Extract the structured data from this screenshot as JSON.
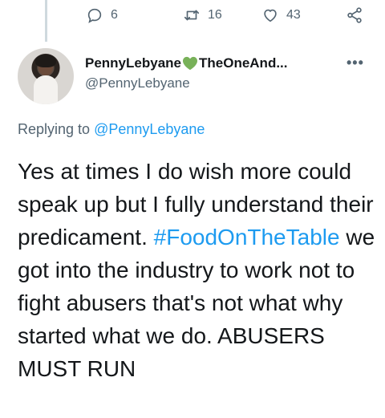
{
  "actions": {
    "reply_icon": "reply-icon",
    "reply_count": "6",
    "retweet_icon": "retweet-icon",
    "retweet_count": "16",
    "like_icon": "heart-icon",
    "like_count": "43",
    "share_icon": "share-icon"
  },
  "tweet": {
    "display_name_part1": "PennyLebyane",
    "display_name_emoji": "green-heart-emoji",
    "display_name_part2": "TheOneAnd...",
    "handle": "@PennyLebyane",
    "more_label": "•••",
    "replying_prefix": "Replying to ",
    "replying_to": "@PennyLebyane",
    "text_part1": "Yes at times I do wish more could speak up but I fully understand their predicament. ",
    "hashtag": "#FoodOnTheTable",
    "text_part2": " we got into the industry to work not to fight abusers that's not what why started what we do. ABUSERS MUST RUN"
  },
  "colors": {
    "link": "#1d9bf0",
    "secondary_text": "#536471",
    "primary_text": "#14171a",
    "heart_emoji": "#78b159"
  }
}
